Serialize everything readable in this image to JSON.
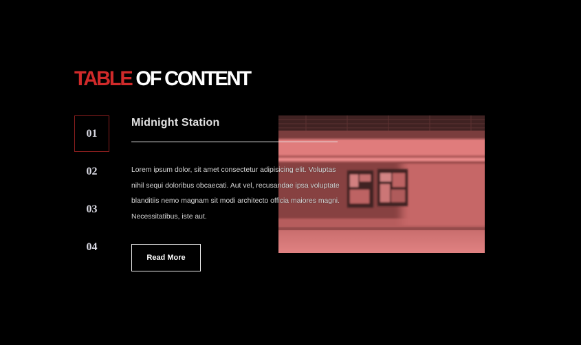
{
  "title": {
    "accent": "TABLE",
    "rest": " OF CONTENT",
    "accent_color": "#d02a2a"
  },
  "nav": {
    "items": [
      {
        "label": "01",
        "active": true
      },
      {
        "label": "02",
        "active": false
      },
      {
        "label": "03",
        "active": false
      },
      {
        "label": "04",
        "active": false
      }
    ]
  },
  "article": {
    "heading": "Midnight Station",
    "body": "Lorem ipsum dolor, sit amet consectetur adipisicing elit. Voluptas nihil sequi doloribus obcaecati. Aut vel, recusandae ipsa voluptate blanditiis nemo magnam sit modi architecto officia maiores magni. Necessitatibus, iste aut.",
    "read_more_label": "Read More",
    "image": "subway-station-motion-blur-photo"
  }
}
